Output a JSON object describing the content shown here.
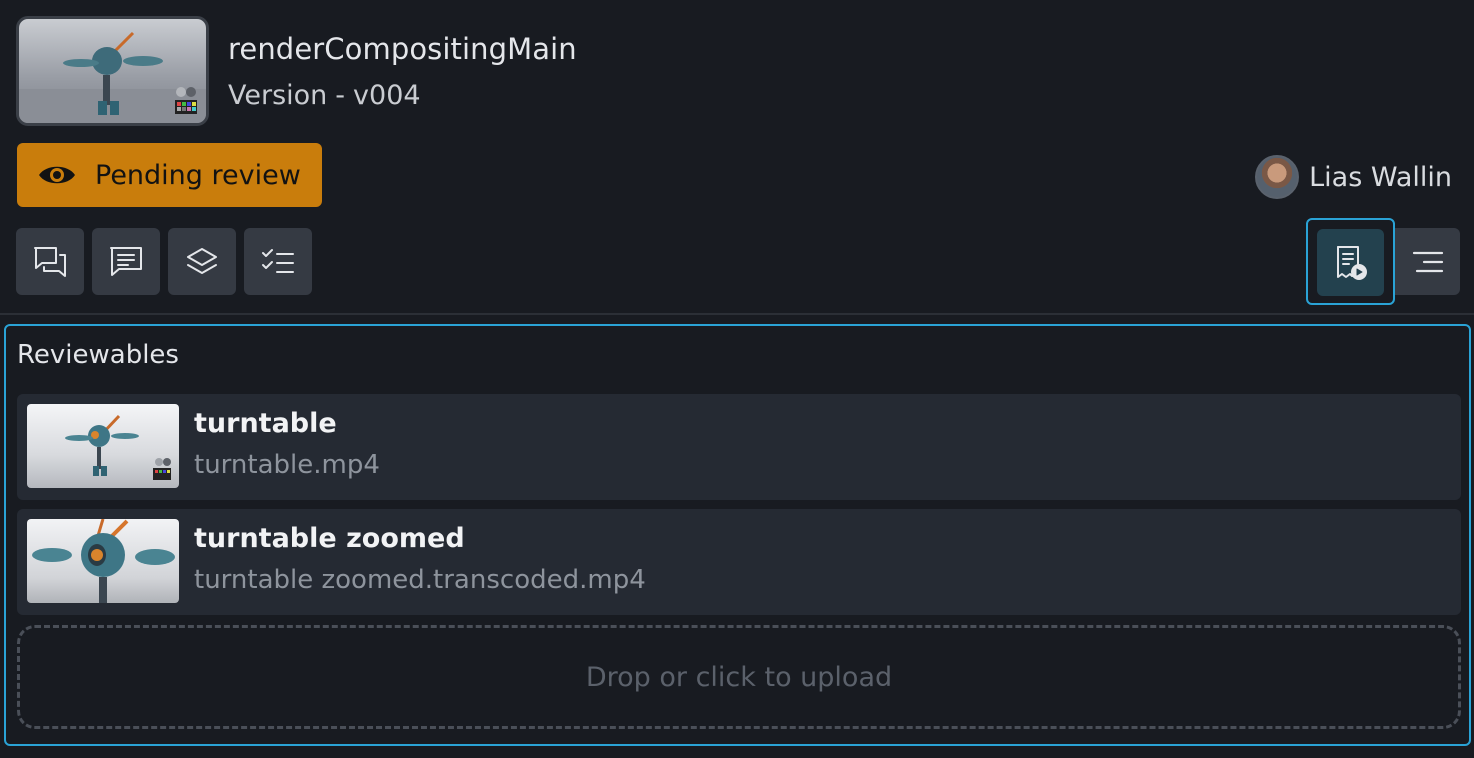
{
  "header": {
    "title": "renderCompositingMain",
    "version_label": "Version",
    "version_sep": "-",
    "version_value": "v004",
    "thumbnail_icon": "robot-render-thumbnail"
  },
  "status": {
    "label": "Pending review",
    "icon": "eye-icon",
    "color": "#c97d0c"
  },
  "user": {
    "name": "Lias Wallin"
  },
  "toolbar": {
    "buttons": [
      {
        "name": "activity-feed-button",
        "icon": "chat-bubbles-icon"
      },
      {
        "name": "comments-button",
        "icon": "comment-lines-icon"
      },
      {
        "name": "layers-button",
        "icon": "layers-icon"
      },
      {
        "name": "checklist-button",
        "icon": "checklist-icon"
      }
    ],
    "right": [
      {
        "name": "reviewables-button",
        "icon": "doc-play-icon",
        "active": true
      },
      {
        "name": "details-button",
        "icon": "menu-lines-icon"
      }
    ]
  },
  "panel": {
    "title": "Reviewables",
    "items": [
      {
        "name": "turntable",
        "file": "turntable.mp4"
      },
      {
        "name": "turntable zoomed",
        "file": "turntable zoomed.transcoded.mp4"
      }
    ],
    "dropzone": "Drop or click to upload"
  },
  "colors": {
    "accent": "#2aa3d6",
    "background": "#181b21",
    "status_pending": "#c97d0c"
  }
}
